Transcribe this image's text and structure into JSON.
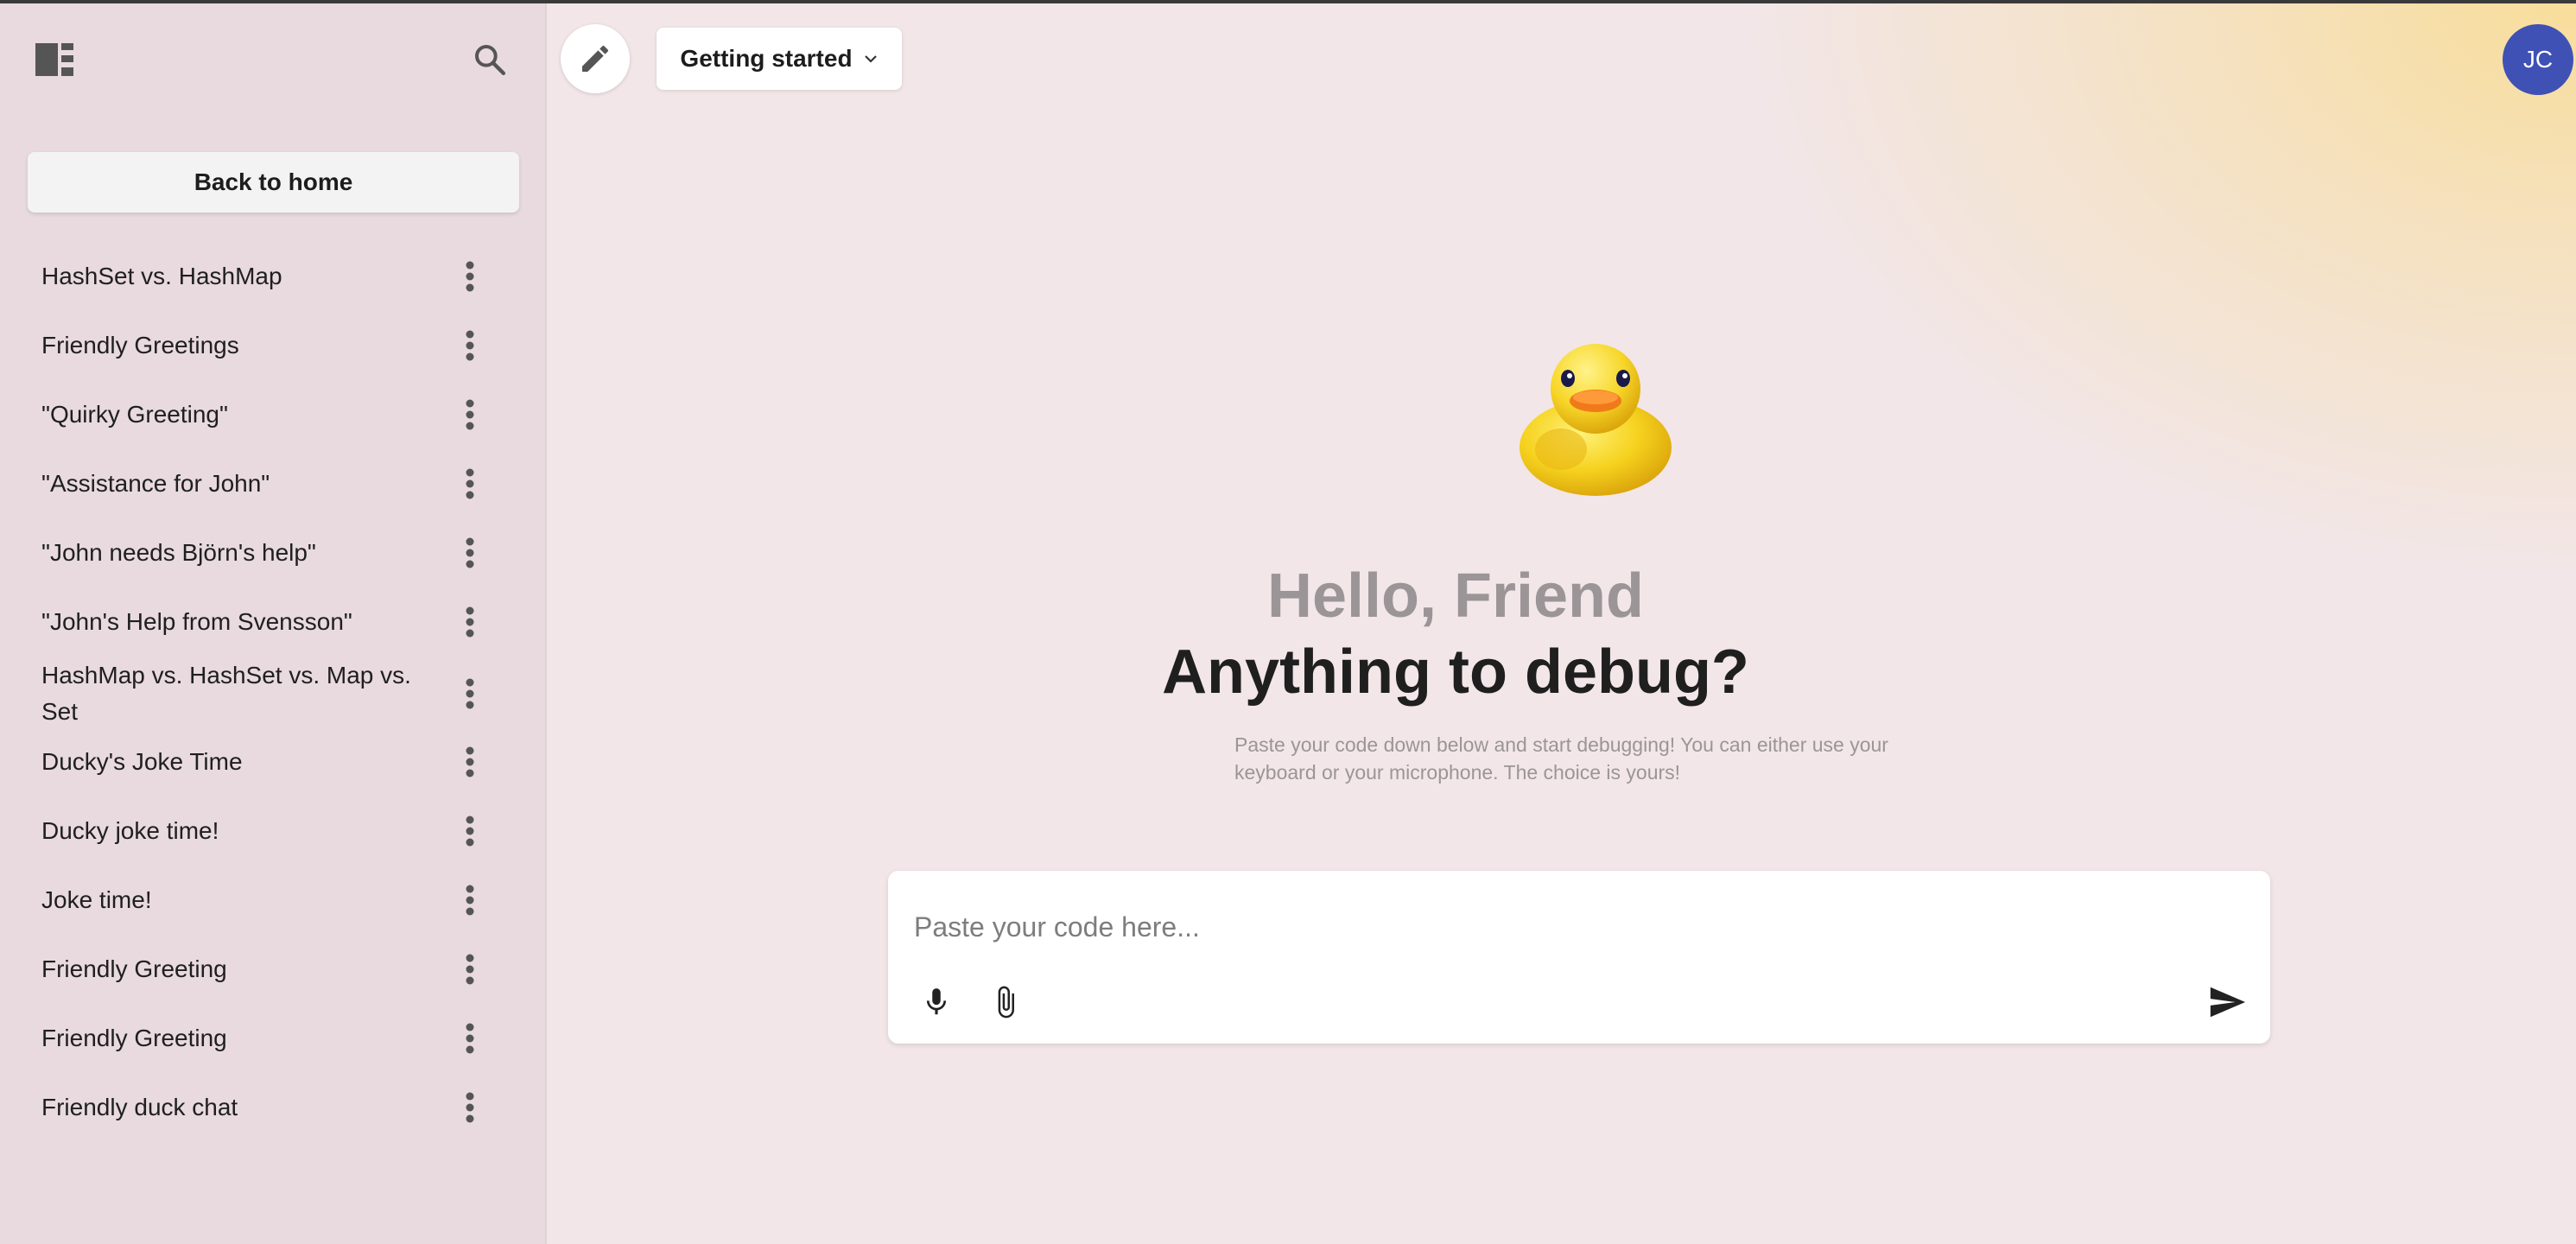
{
  "sidebar": {
    "back_home_label": "Back to home",
    "icons": {
      "panel": "sidebar-panel-icon",
      "search": "search-icon",
      "more": "more-vert-icon"
    },
    "conversations": [
      {
        "label": "HashSet vs. HashMap"
      },
      {
        "label": "Friendly Greetings"
      },
      {
        "label": "\"Quirky Greeting\""
      },
      {
        "label": "\"Assistance for John\""
      },
      {
        "label": "\"John needs Björn's help\""
      },
      {
        "label": "\"John's Help from Svensson\""
      },
      {
        "label": "HashMap vs. HashSet vs. Map vs. Set"
      },
      {
        "label": "Ducky's Joke Time"
      },
      {
        "label": "Ducky joke time!"
      },
      {
        "label": "Joke time!"
      },
      {
        "label": "Friendly Greeting"
      },
      {
        "label": "Friendly Greeting"
      },
      {
        "label": "Friendly duck chat"
      }
    ]
  },
  "header": {
    "model_selector_label": "Getting started",
    "avatar_initials": "JC",
    "icons": {
      "edit": "pencil-icon",
      "dropdown": "chevron-down-icon"
    }
  },
  "hero": {
    "icon": "rubber-duck-icon",
    "greeting": "Hello, Friend",
    "headline": "Anything to debug?",
    "subtext": "Paste your code down below and start debugging! You can either use your keyboard or your microphone. The choice is yours!"
  },
  "composer": {
    "placeholder": "Paste your code here...",
    "value": "",
    "icons": {
      "mic": "microphone-icon",
      "attach": "paperclip-icon",
      "send": "send-icon"
    }
  },
  "colors": {
    "sidebar_bg": "#e8dadf",
    "main_bg": "#f2e6e9",
    "accent_gradient": "#f8dd9a",
    "avatar_bg": "#3f51b5",
    "greeting_text": "#9b9598",
    "headline_text": "#1f1f1f"
  }
}
